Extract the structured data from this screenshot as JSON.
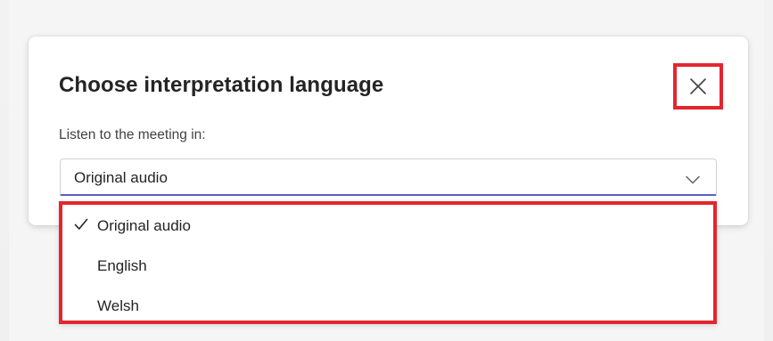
{
  "dialog": {
    "title": "Choose interpretation language",
    "close_icon": "close-icon"
  },
  "field": {
    "label": "Listen to the meeting in:",
    "selected_value": "Original audio",
    "chevron_icon": "chevron-down-icon"
  },
  "dropdown": {
    "options": [
      {
        "label": "Original audio",
        "selected": true
      },
      {
        "label": "English",
        "selected": false
      },
      {
        "label": "Welsh",
        "selected": false
      }
    ],
    "check_icon": "checkmark-icon"
  },
  "colors": {
    "highlight_border": "#e3262f",
    "accent_underline": "#5b5fc7",
    "text": "#242424"
  }
}
